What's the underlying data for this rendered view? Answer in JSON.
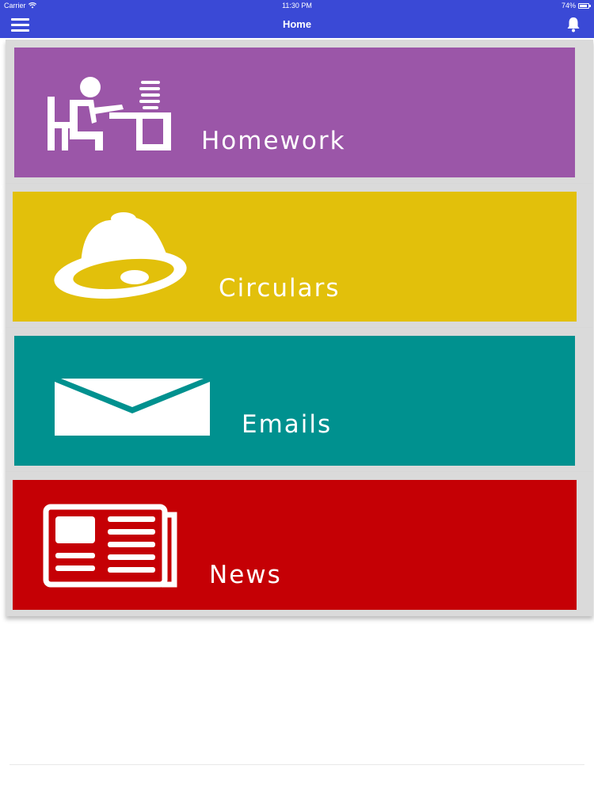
{
  "status_bar": {
    "carrier": "Carrier",
    "time": "11:30 PM",
    "battery": "74%",
    "battery_level": 0.74
  },
  "nav": {
    "title": "Home",
    "menu_icon": "hamburger-menu-icon",
    "notification_icon": "bell-icon"
  },
  "tiles": [
    {
      "label": "Homework",
      "icon": "student-desk-icon",
      "color": "#9b56a8"
    },
    {
      "label": "Circulars",
      "icon": "bell-icon",
      "color": "#e2c00b"
    },
    {
      "label": "Emails",
      "icon": "envelope-icon",
      "color": "#00918f"
    },
    {
      "label": "News",
      "icon": "newspaper-icon",
      "color": "#c50005"
    }
  ]
}
